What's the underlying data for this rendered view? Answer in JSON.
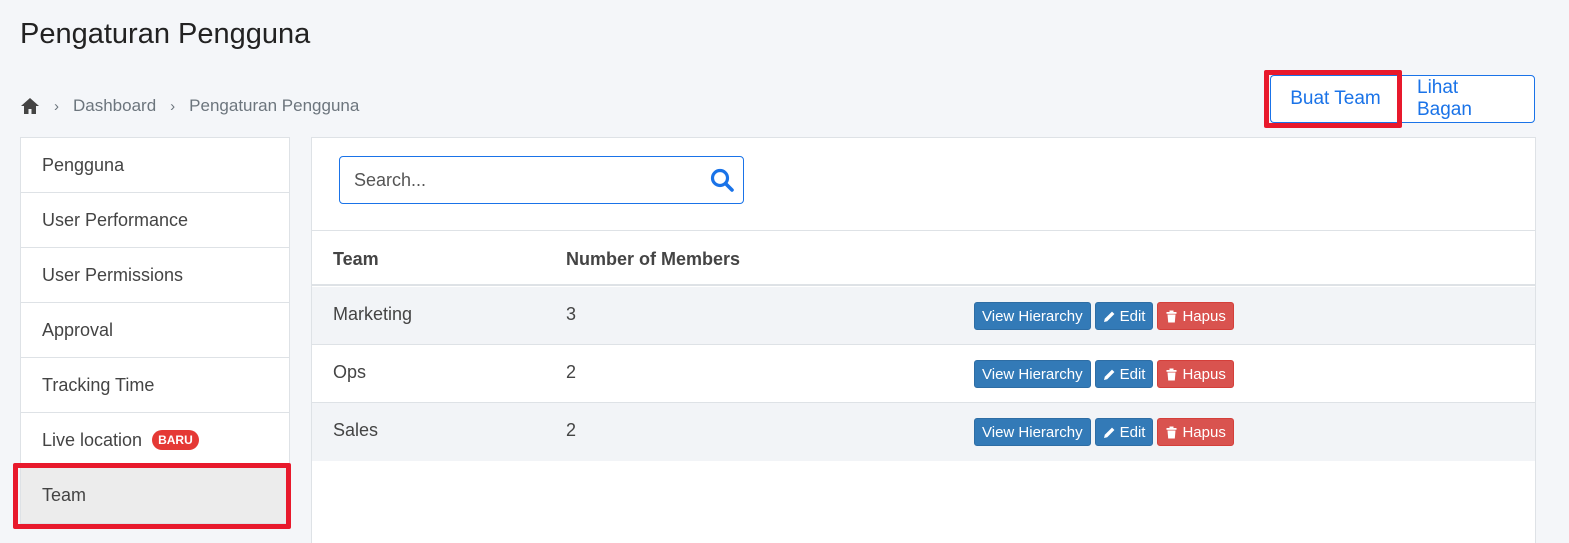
{
  "page": {
    "title": "Pengaturan Pengguna"
  },
  "breadcrumb": {
    "items": [
      "Dashboard",
      "Pengaturan Pengguna"
    ]
  },
  "header_buttons": {
    "create_team": "Buat Team",
    "view_chart": "Lihat Bagan"
  },
  "sidebar": {
    "items": [
      {
        "label": "Pengguna"
      },
      {
        "label": "User Performance"
      },
      {
        "label": "User Permissions"
      },
      {
        "label": "Approval"
      },
      {
        "label": "Tracking Time"
      },
      {
        "label": "Live location",
        "badge": "BARU"
      },
      {
        "label": "Team",
        "active": true
      }
    ]
  },
  "search": {
    "placeholder": "Search..."
  },
  "table": {
    "headers": [
      "Team",
      "Number of Members"
    ],
    "rows": [
      {
        "team": "Marketing",
        "members": "3"
      },
      {
        "team": "Ops",
        "members": "2"
      },
      {
        "team": "Sales",
        "members": "2"
      }
    ],
    "actions": {
      "view": "View Hierarchy",
      "edit": "Edit",
      "delete": "Hapus"
    }
  },
  "colors": {
    "accent": "#1a73e8",
    "highlight": "#e8192c",
    "blue_btn": "#337ab7",
    "red_btn": "#d9534f"
  }
}
